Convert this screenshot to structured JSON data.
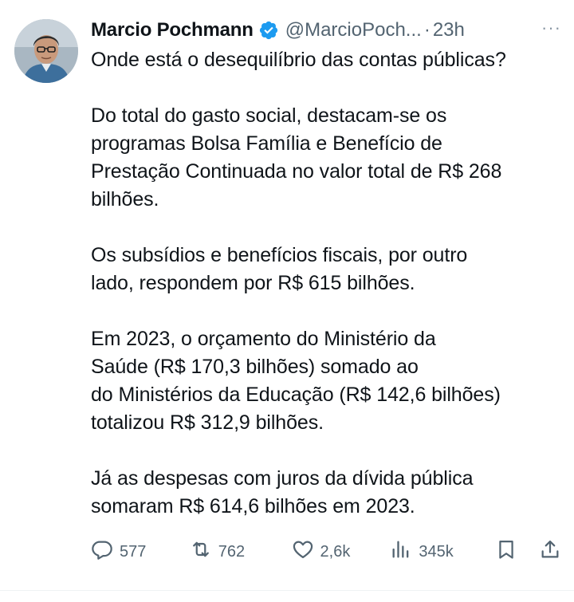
{
  "tweet": {
    "author_name": "Marcio Pochmann",
    "handle": "@MarcioPoch...",
    "separator": "·",
    "time": "23h",
    "more": "···",
    "paragraphs": [
      "Onde está o desequilíbrio das contas públicas?",
      "Do total do gasto social, destacam-se os\nprogramas Bolsa Família e Benefício de\nPrestação Continuada no valor total de R$ 268\nbilhões.",
      "Os subsídios e benefícios fiscais, por outro\nlado, respondem por R$ 615 bilhões.",
      "Em 2023, o orçamento do Ministério da\nSaúde (R$ 170,3 bilhões) somado ao\ndo Ministérios da Educação (R$ 142,6 bilhões)\ntotalizou R$ 312,9 bilhões.",
      "Já as despesas com juros da dívida pública\nsomaram R$ 614,6 bilhões em 2023."
    ],
    "actions": {
      "replies": "577",
      "reposts": "762",
      "likes": "2,6k",
      "views": "345k"
    }
  },
  "colors": {
    "text": "#0f1419",
    "muted": "#536471",
    "verified": "#1d9bf0"
  },
  "icons": [
    "reply-icon",
    "retweet-icon",
    "like-icon",
    "views-icon",
    "bookmark-icon",
    "share-icon",
    "verified-badge-icon"
  ]
}
